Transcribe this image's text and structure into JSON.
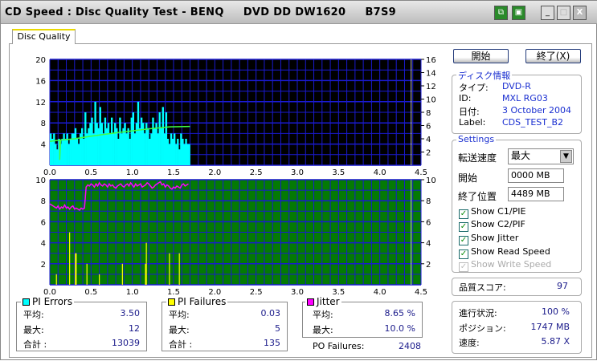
{
  "window": {
    "title": "CD Speed : Disc Quality Test - BENQ     DVD DD DW1620     B7S9",
    "copy_icon": "copy-icon",
    "save_icon": "save-icon",
    "min": "_",
    "max": "□",
    "close": "X"
  },
  "tab": {
    "label": "Disc Quality"
  },
  "buttons": {
    "start": "開始",
    "exit": "終了(X)"
  },
  "disc_info": {
    "title": "ディスク情報",
    "rows": [
      {
        "k": "タイプ:",
        "v": "DVD-R"
      },
      {
        "k": "ID:",
        "v": "MXL RG03"
      },
      {
        "k": "日付:",
        "v": "3 October 2004"
      },
      {
        "k": "Label:",
        "v": "CDS_TEST_B2"
      }
    ]
  },
  "settings": {
    "title": "Settings",
    "speed_label": "転送速度",
    "speed_value": "最大",
    "start_label": "開始",
    "start_value": "0000 MB",
    "end_label": "終了位置",
    "end_value": "4489 MB",
    "checks": [
      {
        "label": "Show C1/PIE",
        "checked": true
      },
      {
        "label": "Show C2/PIF",
        "checked": true
      },
      {
        "label": "Show Jitter",
        "checked": true
      },
      {
        "label": "Show Read Speed",
        "checked": true
      },
      {
        "label": "Show Write Speed",
        "checked": true,
        "disabled": true
      }
    ]
  },
  "quality": {
    "label": "品質スコア:",
    "value": "97"
  },
  "progress": {
    "rows": [
      {
        "k": "進行状況:",
        "v": "100 %"
      },
      {
        "k": "ポジション:",
        "v": "1747 MB"
      },
      {
        "k": "速度:",
        "v": "5.87 X"
      }
    ]
  },
  "stats": {
    "pi_errors": {
      "title": "PI Errors",
      "color": "#00ffff",
      "rows": [
        {
          "k": "平均:",
          "v": "3.50"
        },
        {
          "k": "最大:",
          "v": "12"
        },
        {
          "k": "合計 :",
          "v": "13039"
        }
      ]
    },
    "pi_failures": {
      "title": "PI Failures",
      "color": "#ffff00",
      "rows": [
        {
          "k": "平均:",
          "v": "0.03"
        },
        {
          "k": "最大:",
          "v": "5"
        },
        {
          "k": "合計 :",
          "v": "135"
        }
      ]
    },
    "jitter": {
      "title": "Jitter",
      "color": "#ff00ff",
      "rows": [
        {
          "k": "平均:",
          "v": "8.65 %"
        },
        {
          "k": "最大:",
          "v": "10.0 %"
        }
      ]
    },
    "po_failures": {
      "label": "PO Failures:",
      "value": "2408"
    }
  },
  "chart_data": [
    {
      "type": "bar",
      "title": "PI Errors / Read Speed",
      "xlim": [
        0,
        4.5
      ],
      "ylim": [
        0,
        20
      ],
      "y2lim": [
        0,
        16
      ],
      "xticks": [
        "0.0",
        "0.5",
        "1.0",
        "1.5",
        "2.0",
        "2.5",
        "3.0",
        "3.5",
        "4.0",
        "4.5"
      ],
      "yticks": [
        "4",
        "8",
        "12",
        "16",
        "20"
      ],
      "y2ticks": [
        "2",
        "4",
        "6",
        "8",
        "10",
        "12",
        "14",
        "16"
      ],
      "pi_errors": {
        "x_start": 0,
        "x_step": 0.02,
        "color": "#00ffff",
        "values": [
          6,
          5,
          6,
          4,
          3,
          5,
          4,
          5,
          6,
          5,
          6,
          4,
          5,
          6,
          6,
          7,
          5,
          4,
          6,
          7,
          5,
          10,
          6,
          7,
          8,
          9,
          6,
          12,
          8,
          7,
          11,
          8,
          6,
          9,
          7,
          8,
          6,
          9,
          6,
          8,
          7,
          5,
          9,
          6,
          7,
          8,
          6,
          7,
          5,
          9,
          10,
          6,
          8,
          12,
          7,
          9,
          8,
          6,
          8,
          7,
          5,
          6,
          9,
          7,
          8,
          6,
          10,
          7,
          11,
          6,
          10,
          5,
          4,
          6,
          5,
          6,
          4,
          5,
          3,
          6,
          5,
          4,
          5,
          4,
          4
        ],
        "max_marker": {
          "x": 1.07,
          "y": 12
        }
      },
      "read_speed": {
        "color": "#40ff40",
        "points": [
          [
            0,
            3.6
          ],
          [
            0.12,
            3.8
          ],
          [
            0.12,
            0.8
          ],
          [
            0.13,
            3.8
          ],
          [
            0.3,
            4.0
          ],
          [
            0.5,
            4.4
          ],
          [
            0.8,
            4.9
          ],
          [
            1.0,
            5.2
          ],
          [
            1.2,
            5.5
          ],
          [
            1.45,
            5.8
          ],
          [
            1.7,
            5.87
          ]
        ]
      },
      "end_marker_x": 4.38
    },
    {
      "type": "line",
      "title": "Jitter / PI Failures",
      "xlim": [
        0,
        4.5
      ],
      "ylim": [
        0,
        10
      ],
      "xticks": [
        "0.0",
        "0.5",
        "1.0",
        "1.5",
        "2.0",
        "2.5",
        "3.0",
        "3.5",
        "4.0",
        "4.5"
      ],
      "yticks": [
        "2",
        "4",
        "6",
        "8",
        "10"
      ],
      "y2ticks": [
        "2",
        "4",
        "6",
        "8",
        "10"
      ],
      "jitter": {
        "x_start": 0,
        "x_step": 0.02,
        "color": "#ff00ff",
        "values": [
          7.7,
          7.6,
          7.5,
          7.4,
          7.3,
          7.5,
          7.2,
          7.4,
          7.3,
          7.6,
          7.3,
          7.4,
          7.2,
          7.4,
          7.5,
          7.2,
          7.3,
          7.2,
          7.1,
          7.3,
          7.2,
          7.3,
          9.3,
          9.5,
          9.4,
          9.6,
          9.5,
          9.3,
          9.6,
          9.4,
          9.7,
          9.5,
          9.4,
          9.6,
          9.5,
          9.3,
          9.6,
          9.4,
          9.5,
          9.3,
          9.2,
          9.4,
          9.5,
          9.6,
          9.4,
          9.3,
          9.5,
          9.6,
          9.4,
          9.7,
          9.5,
          9.3,
          9.6,
          9.4,
          9.5,
          9.6,
          9.3,
          9.4,
          9.5,
          9.7,
          9.6,
          9.4,
          9.2,
          9.3,
          9.5,
          9.6,
          9.7,
          9.8,
          9.5,
          9.6,
          9.3,
          9.5,
          9.4,
          9.2,
          9.1,
          9.3,
          9.2,
          9.4,
          9.3,
          9.2,
          9.5,
          9.6,
          9.4,
          9.5,
          9.6
        ]
      },
      "pi_failures": {
        "color": "#ffff00",
        "points": [
          [
            0.08,
            1
          ],
          [
            0.24,
            5
          ],
          [
            0.31,
            3
          ],
          [
            0.32,
            3
          ],
          [
            0.45,
            2
          ],
          [
            0.6,
            1
          ],
          [
            0.88,
            2
          ],
          [
            1.16,
            2
          ],
          [
            1.17,
            4
          ],
          [
            1.45,
            3
          ],
          [
            1.57,
            3
          ]
        ]
      },
      "end_marker_x": 4.38
    }
  ]
}
